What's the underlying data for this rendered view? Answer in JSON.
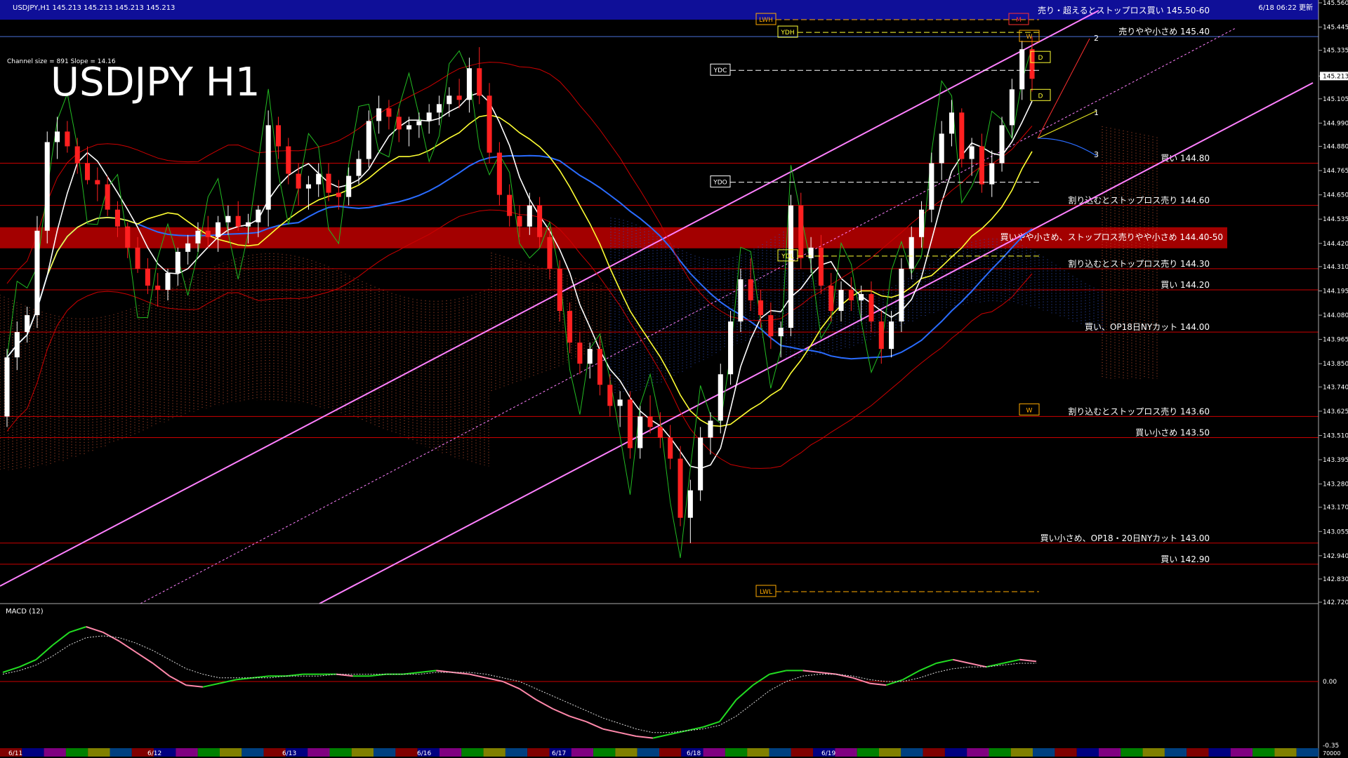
{
  "header": {
    "symbol_info": "USDJPY,H1  145.213 145.213 145.213 145.213",
    "channel_info": "Channel size = 891  Slope = 14.16",
    "big_title": "USDJPY H1",
    "timestamp": "6/18 06:22 更新"
  },
  "chart_data": {
    "type": "candlestick",
    "symbol": "USDJPY",
    "timeframe": "H1",
    "current_price": 145.213,
    "ylim": [
      142.72,
      145.56
    ],
    "y_ticks": [
      145.56,
      145.445,
      145.335,
      145.213,
      145.105,
      144.99,
      144.88,
      144.765,
      144.65,
      144.535,
      144.42,
      144.31,
      144.195,
      144.08,
      143.965,
      143.85,
      143.74,
      143.625,
      143.51,
      143.395,
      143.28,
      143.17,
      143.055,
      142.94,
      142.83,
      142.72
    ],
    "date_labels": [
      "6/11",
      "6/12",
      "6/13",
      "6/16",
      "6/17",
      "6/18",
      "6/19"
    ],
    "levels": [
      {
        "price": 145.55,
        "label": "売り・超えるとストップロス買い 145.50-60",
        "color": "#1010a0",
        "band": true
      },
      {
        "price": 145.4,
        "label": "売りやや小さめ 145.40",
        "color": "#4a6fd8",
        "band": false
      },
      {
        "price": 144.8,
        "label": "買い 144.80",
        "color": "#cc0000",
        "band": false
      },
      {
        "price": 144.6,
        "label": "割り込むとストップロス売り 144.60",
        "color": "#cc0000",
        "band": false
      },
      {
        "price": 144.45,
        "label": "買いやや小さめ、ストップロス売りやや小さめ 144.40-50",
        "color": "#c00000",
        "band": true
      },
      {
        "price": 144.3,
        "label": "割り込むとストップロス売り 144.30",
        "color": "#cc0000",
        "band": false
      },
      {
        "price": 144.2,
        "label": "買い 144.20",
        "color": "#cc0000",
        "band": false
      },
      {
        "price": 144.0,
        "label": "買い、OP18日NYカット 144.00",
        "color": "#cc0000",
        "band": false
      },
      {
        "price": 143.6,
        "label": "割り込むとストップロス売り 143.60",
        "color": "#cc0000",
        "band": false
      },
      {
        "price": 143.5,
        "label": "買い小さめ 143.50",
        "color": "#cc0000",
        "band": false
      },
      {
        "price": 143.0,
        "label": "買い小さめ、OP18・20日NYカット 143.00",
        "color": "#cc0000",
        "band": false
      },
      {
        "price": 142.9,
        "label": "買い 142.90",
        "color": "#cc0000",
        "band": false
      }
    ],
    "reference_labels": [
      {
        "label": "LWH",
        "price": 145.48
      },
      {
        "label": "YDH",
        "price": 145.42
      },
      {
        "label": "YDC",
        "price": 145.24
      },
      {
        "label": "YDO",
        "price": 144.71
      },
      {
        "label": "YDL",
        "price": 144.36
      },
      {
        "label": "LWL",
        "price": 142.77
      },
      {
        "label": "W",
        "price": 145.4
      },
      {
        "label": "M",
        "price": 145.48
      },
      {
        "label": "D",
        "price": 145.3
      },
      {
        "label": "D",
        "price": 145.12
      },
      {
        "label": "W",
        "price": 143.63
      }
    ],
    "projection_labels": [
      "1",
      "2",
      "3"
    ],
    "candles": [
      [
        143.6,
        143.92,
        143.55,
        143.88
      ],
      [
        143.88,
        144.05,
        143.82,
        144.0
      ],
      [
        144.0,
        144.12,
        143.95,
        144.08
      ],
      [
        144.08,
        144.55,
        144.02,
        144.48
      ],
      [
        144.48,
        144.95,
        144.42,
        144.9
      ],
      [
        144.9,
        145.02,
        144.82,
        144.95
      ],
      [
        144.95,
        145.0,
        144.85,
        144.88
      ],
      [
        144.88,
        144.92,
        144.75,
        144.8
      ],
      [
        144.8,
        144.88,
        144.7,
        144.72
      ],
      [
        144.72,
        144.78,
        144.62,
        144.7
      ],
      [
        144.7,
        144.74,
        144.55,
        144.58
      ],
      [
        144.58,
        144.62,
        144.45,
        144.5
      ],
      [
        144.5,
        144.52,
        144.35,
        144.4
      ],
      [
        144.4,
        144.45,
        144.28,
        144.3
      ],
      [
        144.3,
        144.35,
        144.18,
        144.22
      ],
      [
        144.22,
        144.28,
        144.12,
        144.2
      ],
      [
        144.2,
        144.3,
        144.15,
        144.28
      ],
      [
        144.28,
        144.4,
        144.22,
        144.38
      ],
      [
        144.38,
        144.46,
        144.32,
        144.42
      ],
      [
        144.42,
        144.52,
        144.38,
        144.48
      ],
      [
        144.48,
        144.55,
        144.4,
        144.45
      ],
      [
        144.45,
        144.55,
        144.38,
        144.52
      ],
      [
        144.52,
        144.6,
        144.46,
        144.55
      ],
      [
        144.55,
        144.62,
        144.48,
        144.5
      ],
      [
        144.5,
        144.56,
        144.42,
        144.52
      ],
      [
        144.52,
        144.6,
        144.45,
        144.58
      ],
      [
        144.58,
        145.05,
        144.5,
        144.98
      ],
      [
        144.98,
        145.02,
        144.82,
        144.88
      ],
      [
        144.88,
        144.92,
        144.7,
        144.75
      ],
      [
        144.75,
        144.8,
        144.6,
        144.68
      ],
      [
        144.68,
        144.74,
        144.58,
        144.7
      ],
      [
        144.7,
        144.8,
        144.64,
        144.75
      ],
      [
        144.75,
        144.8,
        144.62,
        144.66
      ],
      [
        144.66,
        144.72,
        144.58,
        144.64
      ],
      [
        144.64,
        144.78,
        144.6,
        144.74
      ],
      [
        144.74,
        144.86,
        144.7,
        144.82
      ],
      [
        144.82,
        145.05,
        144.78,
        145.0
      ],
      [
        145.0,
        145.12,
        144.94,
        145.06
      ],
      [
        145.06,
        145.1,
        144.96,
        145.02
      ],
      [
        145.02,
        145.06,
        144.9,
        144.96
      ],
      [
        144.96,
        145.02,
        144.88,
        144.98
      ],
      [
        144.98,
        145.04,
        144.92,
        145.0
      ],
      [
        145.0,
        145.08,
        144.94,
        145.04
      ],
      [
        145.04,
        145.12,
        144.98,
        145.08
      ],
      [
        145.08,
        145.16,
        145.02,
        145.12
      ],
      [
        145.12,
        145.2,
        145.06,
        145.1
      ],
      [
        145.1,
        145.3,
        145.04,
        145.25
      ],
      [
        145.25,
        145.35,
        145.08,
        145.12
      ],
      [
        145.12,
        145.18,
        144.8,
        144.85
      ],
      [
        144.85,
        144.9,
        144.6,
        144.65
      ],
      [
        144.65,
        144.7,
        144.5,
        144.55
      ],
      [
        144.55,
        144.6,
        144.45,
        144.5
      ],
      [
        144.5,
        144.66,
        144.46,
        144.6
      ],
      [
        144.6,
        144.64,
        144.4,
        144.45
      ],
      [
        144.45,
        144.5,
        144.25,
        144.3
      ],
      [
        144.3,
        144.34,
        144.05,
        144.1
      ],
      [
        144.1,
        144.14,
        143.9,
        143.95
      ],
      [
        143.95,
        144.0,
        143.8,
        143.85
      ],
      [
        143.85,
        143.95,
        143.78,
        143.92
      ],
      [
        143.92,
        143.98,
        143.7,
        143.75
      ],
      [
        143.75,
        143.8,
        143.6,
        143.65
      ],
      [
        143.65,
        143.72,
        143.55,
        143.68
      ],
      [
        143.68,
        143.72,
        143.4,
        143.45
      ],
      [
        143.45,
        143.65,
        143.4,
        143.6
      ],
      [
        143.6,
        143.7,
        143.52,
        143.55
      ],
      [
        143.55,
        143.62,
        143.45,
        143.5
      ],
      [
        143.5,
        143.56,
        143.35,
        143.4
      ],
      [
        143.4,
        143.46,
        143.08,
        143.12
      ],
      [
        143.12,
        143.3,
        143.0,
        143.25
      ],
      [
        143.25,
        143.55,
        143.2,
        143.5
      ],
      [
        143.5,
        143.62,
        143.42,
        143.58
      ],
      [
        143.58,
        143.85,
        143.52,
        143.8
      ],
      [
        143.8,
        144.1,
        143.75,
        144.05
      ],
      [
        144.05,
        144.3,
        144.0,
        144.25
      ],
      [
        144.25,
        144.35,
        144.1,
        144.15
      ],
      [
        144.15,
        144.2,
        144.02,
        144.08
      ],
      [
        144.08,
        144.14,
        143.92,
        143.98
      ],
      [
        143.98,
        144.05,
        143.88,
        144.02
      ],
      [
        144.02,
        144.65,
        143.98,
        144.6
      ],
      [
        144.6,
        144.66,
        144.3,
        144.35
      ],
      [
        144.35,
        144.45,
        144.28,
        144.4
      ],
      [
        144.4,
        144.46,
        144.18,
        144.22
      ],
      [
        144.22,
        144.28,
        144.05,
        144.1
      ],
      [
        144.1,
        144.24,
        144.05,
        144.2
      ],
      [
        144.2,
        144.26,
        144.1,
        144.15
      ],
      [
        144.15,
        144.22,
        144.05,
        144.18
      ],
      [
        144.18,
        144.24,
        144.0,
        144.05
      ],
      [
        144.05,
        144.1,
        143.85,
        143.92
      ],
      [
        143.92,
        144.1,
        143.88,
        144.05
      ],
      [
        144.05,
        144.35,
        144.0,
        144.3
      ],
      [
        144.3,
        144.5,
        144.25,
        144.45
      ],
      [
        144.45,
        144.62,
        144.4,
        144.58
      ],
      [
        144.58,
        144.85,
        144.52,
        144.8
      ],
      [
        144.8,
        145.0,
        144.72,
        144.94
      ],
      [
        144.94,
        145.1,
        144.88,
        145.04
      ],
      [
        145.04,
        145.06,
        144.78,
        144.82
      ],
      [
        144.82,
        144.92,
        144.74,
        144.88
      ],
      [
        144.88,
        144.94,
        144.66,
        144.7
      ],
      [
        144.7,
        144.86,
        144.64,
        144.8
      ],
      [
        144.8,
        145.02,
        144.76,
        144.98
      ],
      [
        144.98,
        145.2,
        144.92,
        145.15
      ],
      [
        145.15,
        145.38,
        145.1,
        145.34
      ],
      [
        145.34,
        145.4,
        145.14,
        145.2
      ]
    ],
    "indicator": "MACD (12)",
    "macd_ylim": [
      -0.35,
      0.35
    ],
    "macd_ticks": [
      0.0,
      -0.35
    ],
    "macd_bottom_label": "70000",
    "macd": [
      0.05,
      0.08,
      0.12,
      0.2,
      0.27,
      0.3,
      0.27,
      0.22,
      0.16,
      0.1,
      0.03,
      -0.02,
      -0.03,
      -0.01,
      0.01,
      0.02,
      0.03,
      0.03,
      0.04,
      0.04,
      0.04,
      0.03,
      0.03,
      0.04,
      0.04,
      0.05,
      0.06,
      0.05,
      0.04,
      0.02,
      0.0,
      -0.04,
      -0.1,
      -0.15,
      -0.19,
      -0.22,
      -0.26,
      -0.28,
      -0.3,
      -0.31,
      -0.29,
      -0.27,
      -0.25,
      -0.22,
      -0.1,
      -0.02,
      0.04,
      0.06,
      0.06,
      0.05,
      0.04,
      0.02,
      -0.01,
      -0.02,
      0.01,
      0.06,
      0.1,
      0.12,
      0.1,
      0.08,
      0.1,
      0.12,
      0.11
    ],
    "signal": [
      0.04,
      0.06,
      0.09,
      0.14,
      0.2,
      0.24,
      0.25,
      0.24,
      0.21,
      0.17,
      0.12,
      0.07,
      0.04,
      0.02,
      0.02,
      0.02,
      0.02,
      0.03,
      0.03,
      0.03,
      0.04,
      0.04,
      0.04,
      0.04,
      0.04,
      0.04,
      0.05,
      0.05,
      0.05,
      0.04,
      0.02,
      0.0,
      -0.04,
      -0.08,
      -0.12,
      -0.16,
      -0.2,
      -0.23,
      -0.26,
      -0.28,
      -0.28,
      -0.27,
      -0.26,
      -0.24,
      -0.19,
      -0.12,
      -0.05,
      0.0,
      0.03,
      0.04,
      0.04,
      0.03,
      0.01,
      0.0,
      0.0,
      0.02,
      0.05,
      0.07,
      0.08,
      0.08,
      0.09,
      0.1,
      0.1
    ]
  }
}
